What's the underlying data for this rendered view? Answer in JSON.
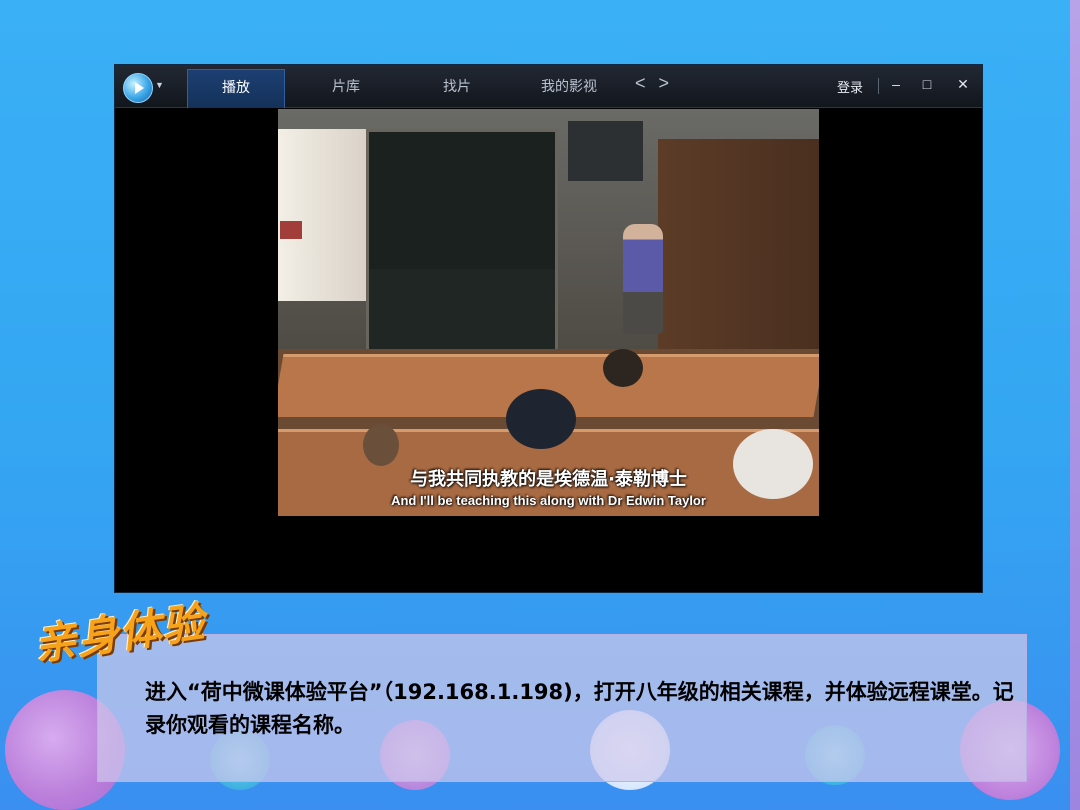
{
  "player": {
    "tabs": [
      {
        "label": "播放",
        "active": true
      },
      {
        "label": "片库",
        "active": false
      },
      {
        "label": "找片",
        "active": false
      },
      {
        "label": "我的影视",
        "active": false
      }
    ],
    "nav_arrows": "< >",
    "login_label": "登录",
    "window_controls": {
      "minimize": "–",
      "maximize": "□",
      "close": "✕"
    },
    "subtitle_cn": "与我共同执教的是埃德温·泰勒博士",
    "subtitle_en": "And I'll be teaching this along with Dr Edwin Taylor"
  },
  "slide": {
    "heading": "亲身体验",
    "body": "进入“荷中微课体验平台”（192.168.1.198)，打开八年级的相关课程，并体验远程课堂。记录你观看的课程名称。"
  },
  "colors": {
    "background": "#36aaf3",
    "panel": "#cdc8ec",
    "heading": "#f7a21b"
  }
}
